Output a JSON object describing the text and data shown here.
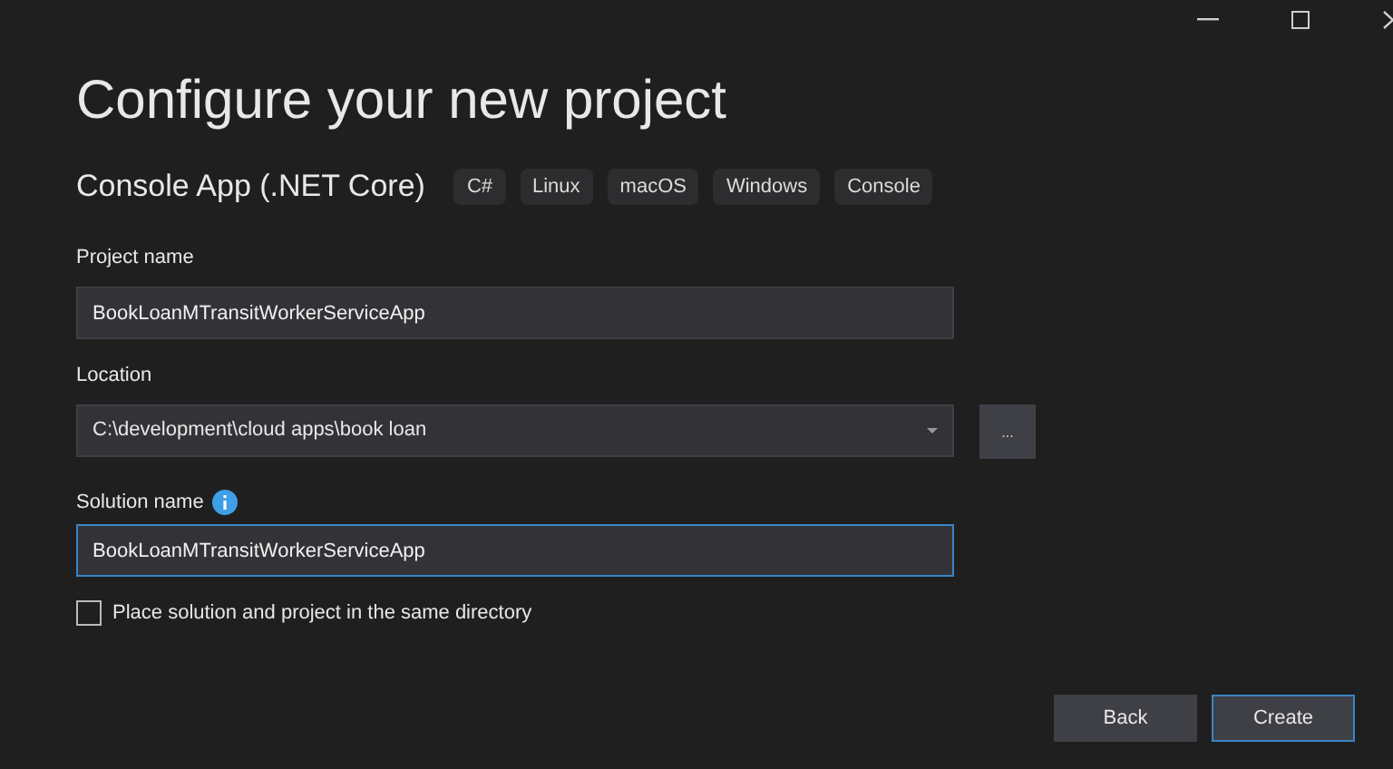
{
  "window": {
    "title": "Configure your new project"
  },
  "template": {
    "name": "Console App (.NET Core)",
    "tags": [
      "C#",
      "Linux",
      "macOS",
      "Windows",
      "Console"
    ]
  },
  "project_name": {
    "label": "Project name",
    "value": "BookLoanMTransitWorkerServiceApp"
  },
  "location": {
    "label": "Location",
    "value": "C:\\development\\cloud apps\\book loan",
    "browse": "..."
  },
  "solution_name": {
    "label": "Solution name",
    "value": "BookLoanMTransitWorkerServiceApp"
  },
  "same_directory": {
    "label": "Place solution and project in the same directory",
    "checked": false
  },
  "buttons": [
    {
      "label": "Back",
      "default": false
    },
    {
      "label": "Create",
      "default": true
    }
  ]
}
